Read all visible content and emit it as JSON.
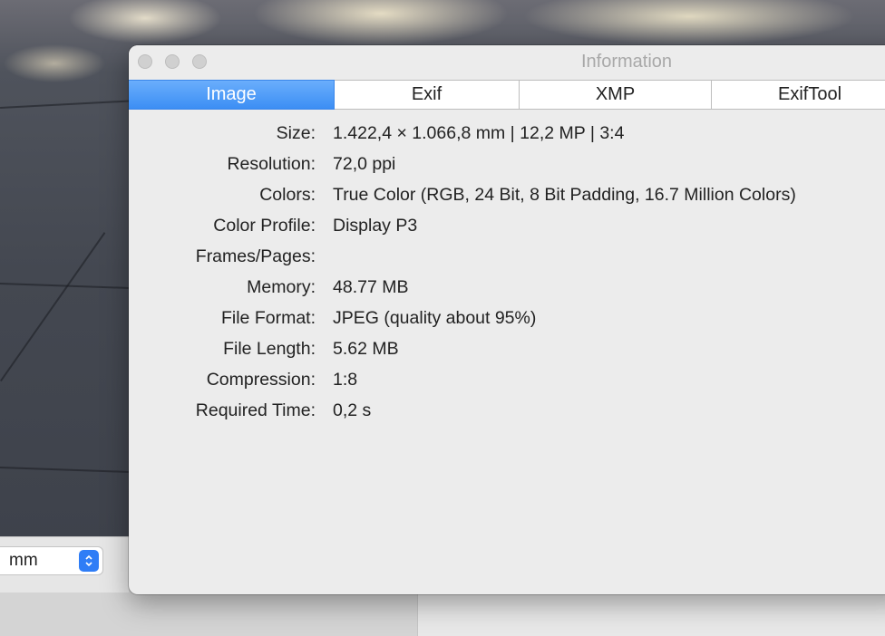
{
  "window": {
    "title": "Information",
    "tabs": [
      {
        "label": "Image",
        "active": true
      },
      {
        "label": "Exif",
        "active": false
      },
      {
        "label": "XMP",
        "active": false
      },
      {
        "label": "ExifTool",
        "active": false
      }
    ],
    "rows": [
      {
        "label": "Size:",
        "value": "1.422,4 × 1.066,8 mm | 12,2 MP | 3:4"
      },
      {
        "label": "Resolution:",
        "value": "72,0 ppi"
      },
      {
        "label": "Colors:",
        "value": "True Color (RGB, 24 Bit, 8 Bit Padding, 16.7 Million Colors)"
      },
      {
        "label": "Color Profile:",
        "value": "Display P3"
      },
      {
        "label": "Frames/Pages:",
        "value": ""
      },
      {
        "label": "Memory:",
        "value": "48.77 MB"
      },
      {
        "label": "File Format:",
        "value": "JPEG (quality about 95%)"
      },
      {
        "label": "File Length:",
        "value": "5.62 MB"
      },
      {
        "label": "Compression:",
        "value": "1:8"
      },
      {
        "label": "Required Time:",
        "value": "0,2 s"
      }
    ]
  },
  "unit_select": {
    "value": "mm",
    "icon": "stepper-chevrons-icon"
  },
  "colors": {
    "accent": "#3c8ef4",
    "window_bg": "#ececec",
    "title_text": "#a8a8a8"
  }
}
